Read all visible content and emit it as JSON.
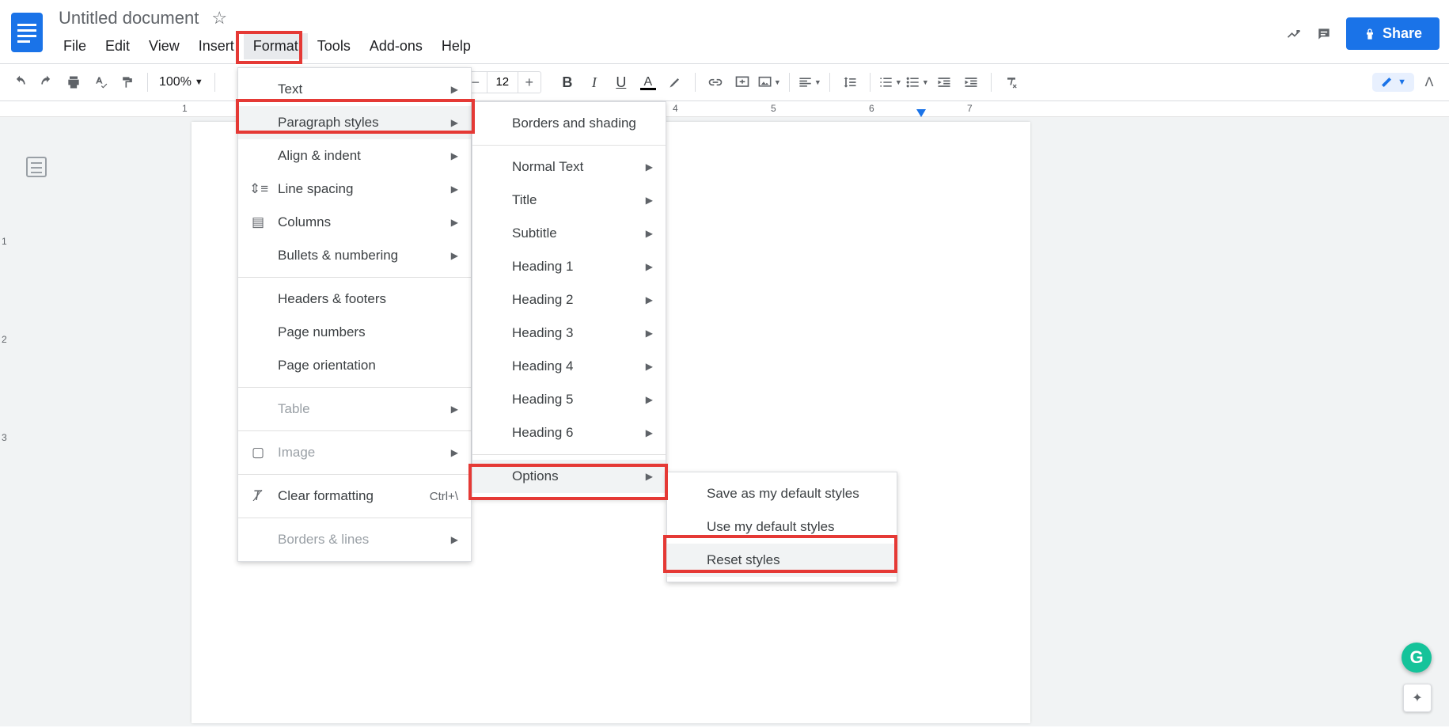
{
  "document": {
    "title": "Untitled document"
  },
  "menubar": {
    "file": "File",
    "edit": "Edit",
    "view": "View",
    "insert": "Insert",
    "format": "Format",
    "tools": "Tools",
    "addons": "Add-ons",
    "help": "Help"
  },
  "header": {
    "share": "Share"
  },
  "toolbar": {
    "zoom": "100%",
    "font_size": "12"
  },
  "ruler": {
    "n1": "1",
    "n4": "4",
    "n5": "5",
    "n6": "6",
    "n7": "7"
  },
  "vruler": {
    "n1": "1",
    "n2": "2",
    "n3": "3"
  },
  "format_menu": {
    "text": "Text",
    "paragraph_styles": "Paragraph styles",
    "align_indent": "Align & indent",
    "line_spacing": "Line spacing",
    "columns": "Columns",
    "bullets_numbering": "Bullets & numbering",
    "headers_footers": "Headers & footers",
    "page_numbers": "Page numbers",
    "page_orientation": "Page orientation",
    "table": "Table",
    "image": "Image",
    "clear_formatting": "Clear formatting",
    "clear_formatting_sc": "Ctrl+\\",
    "borders_lines": "Borders & lines"
  },
  "paragraph_menu": {
    "borders_shading": "Borders and shading",
    "normal_text": "Normal Text",
    "title": "Title",
    "subtitle": "Subtitle",
    "h1": "Heading 1",
    "h2": "Heading 2",
    "h3": "Heading 3",
    "h4": "Heading 4",
    "h5": "Heading 5",
    "h6": "Heading 6",
    "options": "Options"
  },
  "options_menu": {
    "save_default": "Save as my default styles",
    "use_default": "Use my default styles",
    "reset": "Reset styles"
  }
}
